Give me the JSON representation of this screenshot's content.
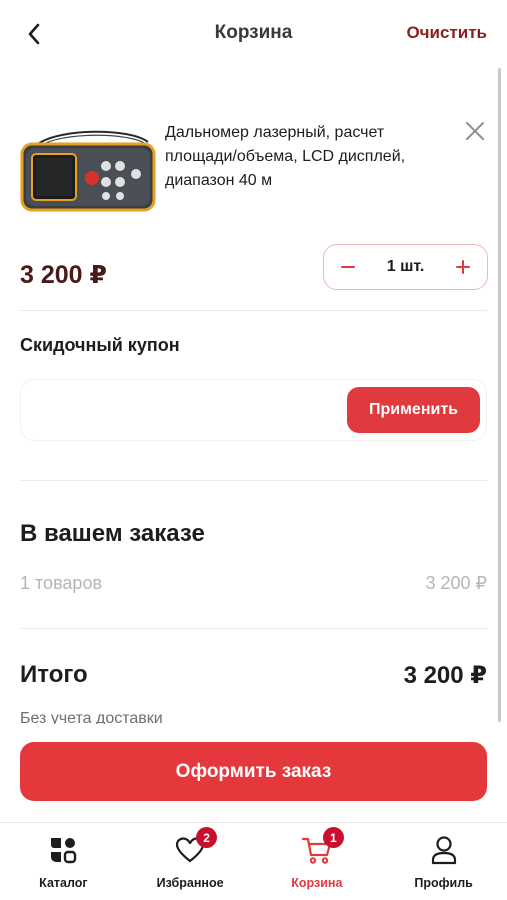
{
  "header": {
    "title": "Корзина",
    "clear_label": "Очистить"
  },
  "cart": {
    "items": [
      {
        "name": "Дальномер лазерный, расчет площади/объема, LCD дисплей, диапазон 40 м",
        "price": "3 200 ₽",
        "quantity": "1 шт."
      }
    ]
  },
  "coupon": {
    "title": "Скидочный купон",
    "input_value": "",
    "input_placeholder": "",
    "apply_label": "Применить"
  },
  "order": {
    "title": "В вашем заказе",
    "items_count_label": "1 товаров",
    "items_sum": "3 200 ₽",
    "total_label": "Итого",
    "total_value": "3 200 ₽",
    "delivery_note": "Без учета доставки"
  },
  "checkout_label": "Оформить заказ",
  "colors": {
    "accent": "#e5383d",
    "badge": "#c8102e",
    "clear_text": "#8b1f1f"
  },
  "bottom_nav": {
    "items": [
      {
        "label": "Каталог",
        "icon": "catalog-icon",
        "active": false
      },
      {
        "label": "Избранное",
        "icon": "heart-icon",
        "badge": "2",
        "active": false
      },
      {
        "label": "Корзина",
        "icon": "cart-icon",
        "badge": "1",
        "active": true
      },
      {
        "label": "Профиль",
        "icon": "profile-icon",
        "active": false
      }
    ]
  }
}
